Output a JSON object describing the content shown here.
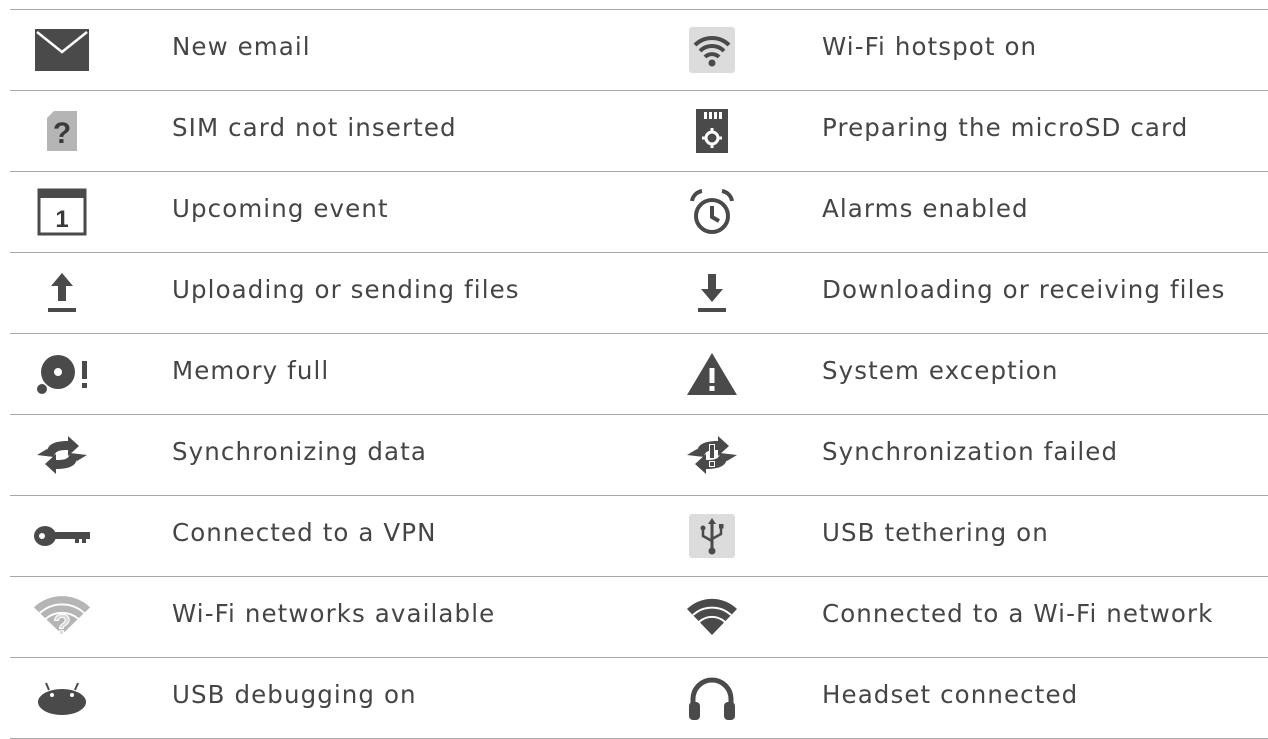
{
  "rows": [
    {
      "left": {
        "icon": "email-icon",
        "label": "New email"
      },
      "right": {
        "icon": "wifi-hotspot-icon",
        "label": "Wi-Fi hotspot on"
      }
    },
    {
      "left": {
        "icon": "sim-missing-icon",
        "label": "SIM card not inserted"
      },
      "right": {
        "icon": "microsd-icon",
        "label": "Preparing the microSD card"
      }
    },
    {
      "left": {
        "icon": "calendar-icon",
        "label": "Upcoming event",
        "calendar_number": "1"
      },
      "right": {
        "icon": "alarm-icon",
        "label": "Alarms enabled"
      }
    },
    {
      "left": {
        "icon": "upload-icon",
        "label": "Uploading or sending files"
      },
      "right": {
        "icon": "download-icon",
        "label": "Downloading or receiving files"
      }
    },
    {
      "left": {
        "icon": "memory-full-icon",
        "label": "Memory full"
      },
      "right": {
        "icon": "warning-icon",
        "label": "System exception"
      }
    },
    {
      "left": {
        "icon": "sync-icon",
        "label": "Synchronizing data"
      },
      "right": {
        "icon": "sync-failed-icon",
        "label": "Synchronization failed"
      }
    },
    {
      "left": {
        "icon": "vpn-key-icon",
        "label": "Connected to a VPN"
      },
      "right": {
        "icon": "usb-tether-icon",
        "label": "USB tethering on"
      }
    },
    {
      "left": {
        "icon": "wifi-available-icon",
        "label": "Wi-Fi networks available"
      },
      "right": {
        "icon": "wifi-connected-icon",
        "label": "Connected to a Wi-Fi network"
      }
    },
    {
      "left": {
        "icon": "usb-debug-icon",
        "label": "USB debugging on"
      },
      "right": {
        "icon": "headset-icon",
        "label": "Headset connected"
      }
    }
  ],
  "colors": {
    "icon": "#4a4a4a",
    "icon_light": "#b5b5b5",
    "icon_bg": "#dcdcdc",
    "text": "#454545",
    "rule": "#a8a8a8"
  }
}
